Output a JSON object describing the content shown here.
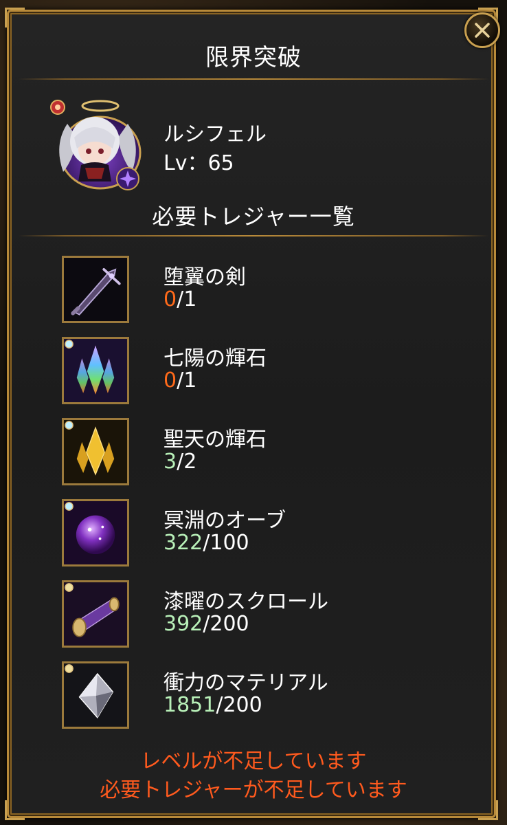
{
  "dialog": {
    "title": "限界突破",
    "close_icon": "close-icon"
  },
  "character": {
    "name": "ルシフェル",
    "level_label": "Lv：65",
    "avatar_icon": "character-portrait-icon"
  },
  "treasure_list": {
    "heading": "必要トレジャー一覧",
    "items": [
      {
        "name": "堕翼の剣",
        "have": "0",
        "need": "1",
        "status": "lack",
        "icon": "fallen-wing-sword-icon"
      },
      {
        "name": "七陽の輝石",
        "have": "0",
        "need": "1",
        "status": "lack",
        "icon": "rainbow-crystal-icon"
      },
      {
        "name": "聖天の輝石",
        "have": "3",
        "need": "2",
        "status": "ok",
        "icon": "golden-crystal-icon"
      },
      {
        "name": "冥淵のオーブ",
        "have": "322",
        "need": "100",
        "status": "ok",
        "icon": "purple-orb-icon"
      },
      {
        "name": "漆曜のスクロール",
        "have": "392",
        "need": "200",
        "status": "ok",
        "icon": "scroll-icon"
      },
      {
        "name": "衝力のマテリアル",
        "have": "1851",
        "need": "200",
        "status": "ok",
        "icon": "silver-material-icon"
      }
    ]
  },
  "warnings": {
    "level": "レベルが不足しています",
    "treasure": "必要トレジャーが不足しています"
  },
  "colors": {
    "lack": "#ff6a1a",
    "ok": "#b8f0b8",
    "warning": "#ff5a1e",
    "frame_gold": "#b88a3a"
  }
}
